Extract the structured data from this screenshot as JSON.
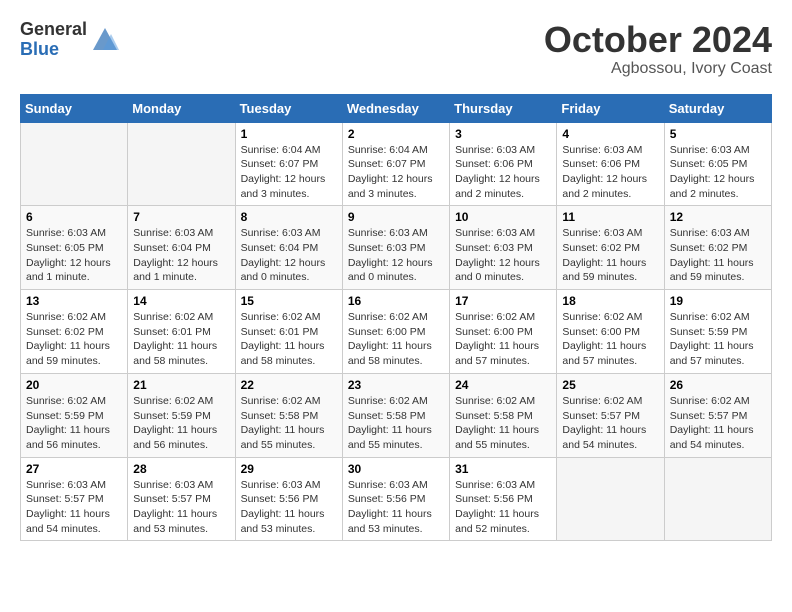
{
  "logo": {
    "general": "General",
    "blue": "Blue"
  },
  "title": "October 2024",
  "location": "Agbossou, Ivory Coast",
  "days_of_week": [
    "Sunday",
    "Monday",
    "Tuesday",
    "Wednesday",
    "Thursday",
    "Friday",
    "Saturday"
  ],
  "weeks": [
    [
      {
        "day": "",
        "info": ""
      },
      {
        "day": "",
        "info": ""
      },
      {
        "day": "1",
        "info": "Sunrise: 6:04 AM\nSunset: 6:07 PM\nDaylight: 12 hours and 3 minutes."
      },
      {
        "day": "2",
        "info": "Sunrise: 6:04 AM\nSunset: 6:07 PM\nDaylight: 12 hours and 3 minutes."
      },
      {
        "day": "3",
        "info": "Sunrise: 6:03 AM\nSunset: 6:06 PM\nDaylight: 12 hours and 2 minutes."
      },
      {
        "day": "4",
        "info": "Sunrise: 6:03 AM\nSunset: 6:06 PM\nDaylight: 12 hours and 2 minutes."
      },
      {
        "day": "5",
        "info": "Sunrise: 6:03 AM\nSunset: 6:05 PM\nDaylight: 12 hours and 2 minutes."
      }
    ],
    [
      {
        "day": "6",
        "info": "Sunrise: 6:03 AM\nSunset: 6:05 PM\nDaylight: 12 hours and 1 minute."
      },
      {
        "day": "7",
        "info": "Sunrise: 6:03 AM\nSunset: 6:04 PM\nDaylight: 12 hours and 1 minute."
      },
      {
        "day": "8",
        "info": "Sunrise: 6:03 AM\nSunset: 6:04 PM\nDaylight: 12 hours and 0 minutes."
      },
      {
        "day": "9",
        "info": "Sunrise: 6:03 AM\nSunset: 6:03 PM\nDaylight: 12 hours and 0 minutes."
      },
      {
        "day": "10",
        "info": "Sunrise: 6:03 AM\nSunset: 6:03 PM\nDaylight: 12 hours and 0 minutes."
      },
      {
        "day": "11",
        "info": "Sunrise: 6:03 AM\nSunset: 6:02 PM\nDaylight: 11 hours and 59 minutes."
      },
      {
        "day": "12",
        "info": "Sunrise: 6:03 AM\nSunset: 6:02 PM\nDaylight: 11 hours and 59 minutes."
      }
    ],
    [
      {
        "day": "13",
        "info": "Sunrise: 6:02 AM\nSunset: 6:02 PM\nDaylight: 11 hours and 59 minutes."
      },
      {
        "day": "14",
        "info": "Sunrise: 6:02 AM\nSunset: 6:01 PM\nDaylight: 11 hours and 58 minutes."
      },
      {
        "day": "15",
        "info": "Sunrise: 6:02 AM\nSunset: 6:01 PM\nDaylight: 11 hours and 58 minutes."
      },
      {
        "day": "16",
        "info": "Sunrise: 6:02 AM\nSunset: 6:00 PM\nDaylight: 11 hours and 58 minutes."
      },
      {
        "day": "17",
        "info": "Sunrise: 6:02 AM\nSunset: 6:00 PM\nDaylight: 11 hours and 57 minutes."
      },
      {
        "day": "18",
        "info": "Sunrise: 6:02 AM\nSunset: 6:00 PM\nDaylight: 11 hours and 57 minutes."
      },
      {
        "day": "19",
        "info": "Sunrise: 6:02 AM\nSunset: 5:59 PM\nDaylight: 11 hours and 57 minutes."
      }
    ],
    [
      {
        "day": "20",
        "info": "Sunrise: 6:02 AM\nSunset: 5:59 PM\nDaylight: 11 hours and 56 minutes."
      },
      {
        "day": "21",
        "info": "Sunrise: 6:02 AM\nSunset: 5:59 PM\nDaylight: 11 hours and 56 minutes."
      },
      {
        "day": "22",
        "info": "Sunrise: 6:02 AM\nSunset: 5:58 PM\nDaylight: 11 hours and 55 minutes."
      },
      {
        "day": "23",
        "info": "Sunrise: 6:02 AM\nSunset: 5:58 PM\nDaylight: 11 hours and 55 minutes."
      },
      {
        "day": "24",
        "info": "Sunrise: 6:02 AM\nSunset: 5:58 PM\nDaylight: 11 hours and 55 minutes."
      },
      {
        "day": "25",
        "info": "Sunrise: 6:02 AM\nSunset: 5:57 PM\nDaylight: 11 hours and 54 minutes."
      },
      {
        "day": "26",
        "info": "Sunrise: 6:02 AM\nSunset: 5:57 PM\nDaylight: 11 hours and 54 minutes."
      }
    ],
    [
      {
        "day": "27",
        "info": "Sunrise: 6:03 AM\nSunset: 5:57 PM\nDaylight: 11 hours and 54 minutes."
      },
      {
        "day": "28",
        "info": "Sunrise: 6:03 AM\nSunset: 5:57 PM\nDaylight: 11 hours and 53 minutes."
      },
      {
        "day": "29",
        "info": "Sunrise: 6:03 AM\nSunset: 5:56 PM\nDaylight: 11 hours and 53 minutes."
      },
      {
        "day": "30",
        "info": "Sunrise: 6:03 AM\nSunset: 5:56 PM\nDaylight: 11 hours and 53 minutes."
      },
      {
        "day": "31",
        "info": "Sunrise: 6:03 AM\nSunset: 5:56 PM\nDaylight: 11 hours and 52 minutes."
      },
      {
        "day": "",
        "info": ""
      },
      {
        "day": "",
        "info": ""
      }
    ]
  ]
}
